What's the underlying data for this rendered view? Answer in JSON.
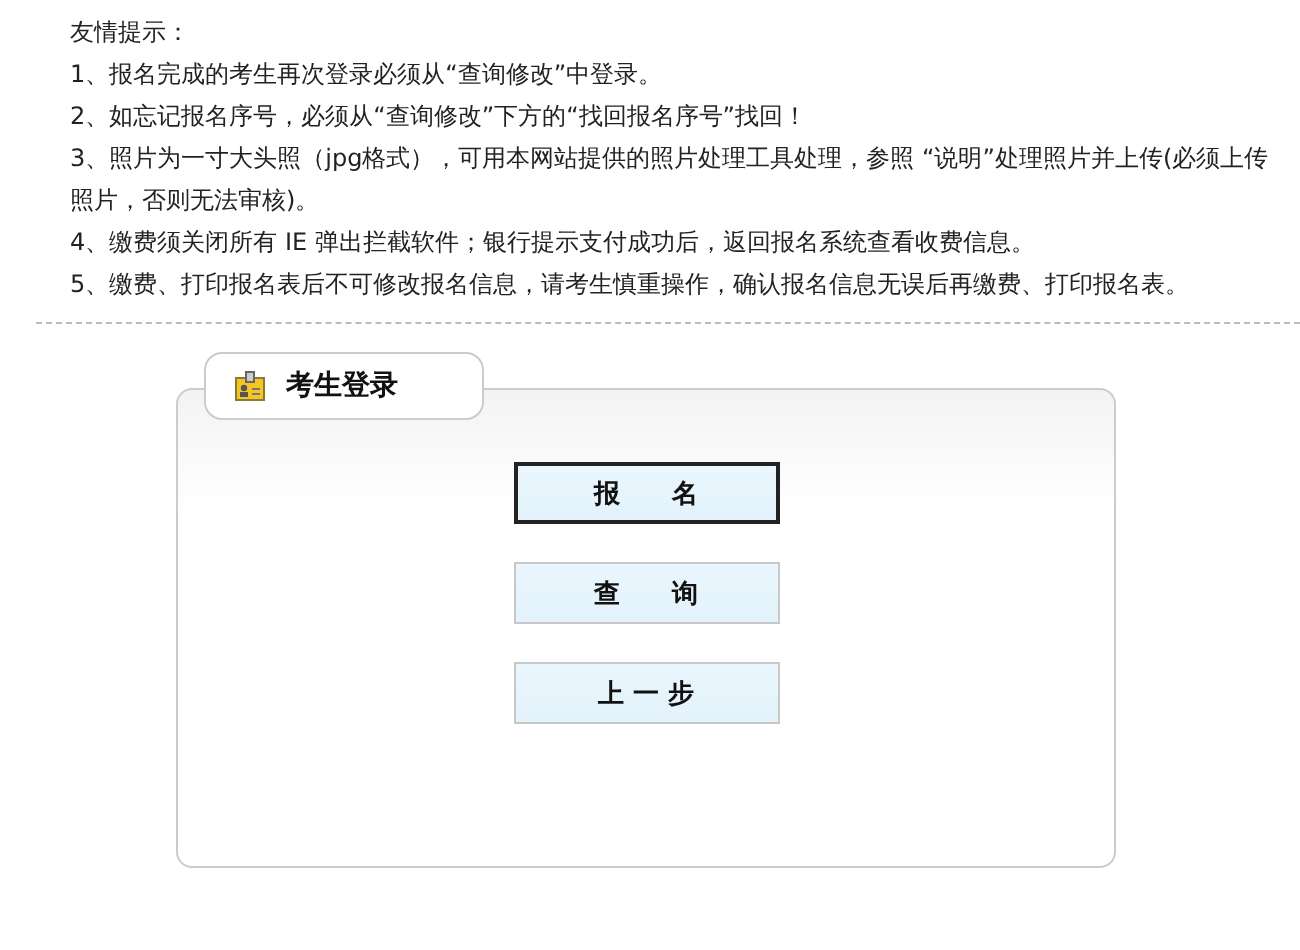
{
  "notice": {
    "title": "友情提示：",
    "items": [
      "1、报名完成的考生再次登录必须从“查询修改”中登录。",
      "2、如忘记报名序号，必须从“查询修改”下方的“找回报名序号”找回！",
      "3、照片为一寸大头照（jpg格式），可用本网站提供的照片处理工具处理，参照 “说明”处理照片并上传(必须上传照片，否则无法审核)。",
      "4、缴费须关闭所有 IE 弹出拦截软件；银行提示支付成功后，返回报名系统查看收费信息。",
      "5、缴费、打印报名表后不可修改报名信息，请考生慎重操作，确认报名信息无误后再缴费、打印报名表。"
    ]
  },
  "login_panel": {
    "title": "考生登录",
    "buttons": [
      {
        "label": "报　　名",
        "selected": true
      },
      {
        "label": "查　　询",
        "selected": false
      },
      {
        "label": "上 一 步",
        "selected": false
      }
    ]
  }
}
